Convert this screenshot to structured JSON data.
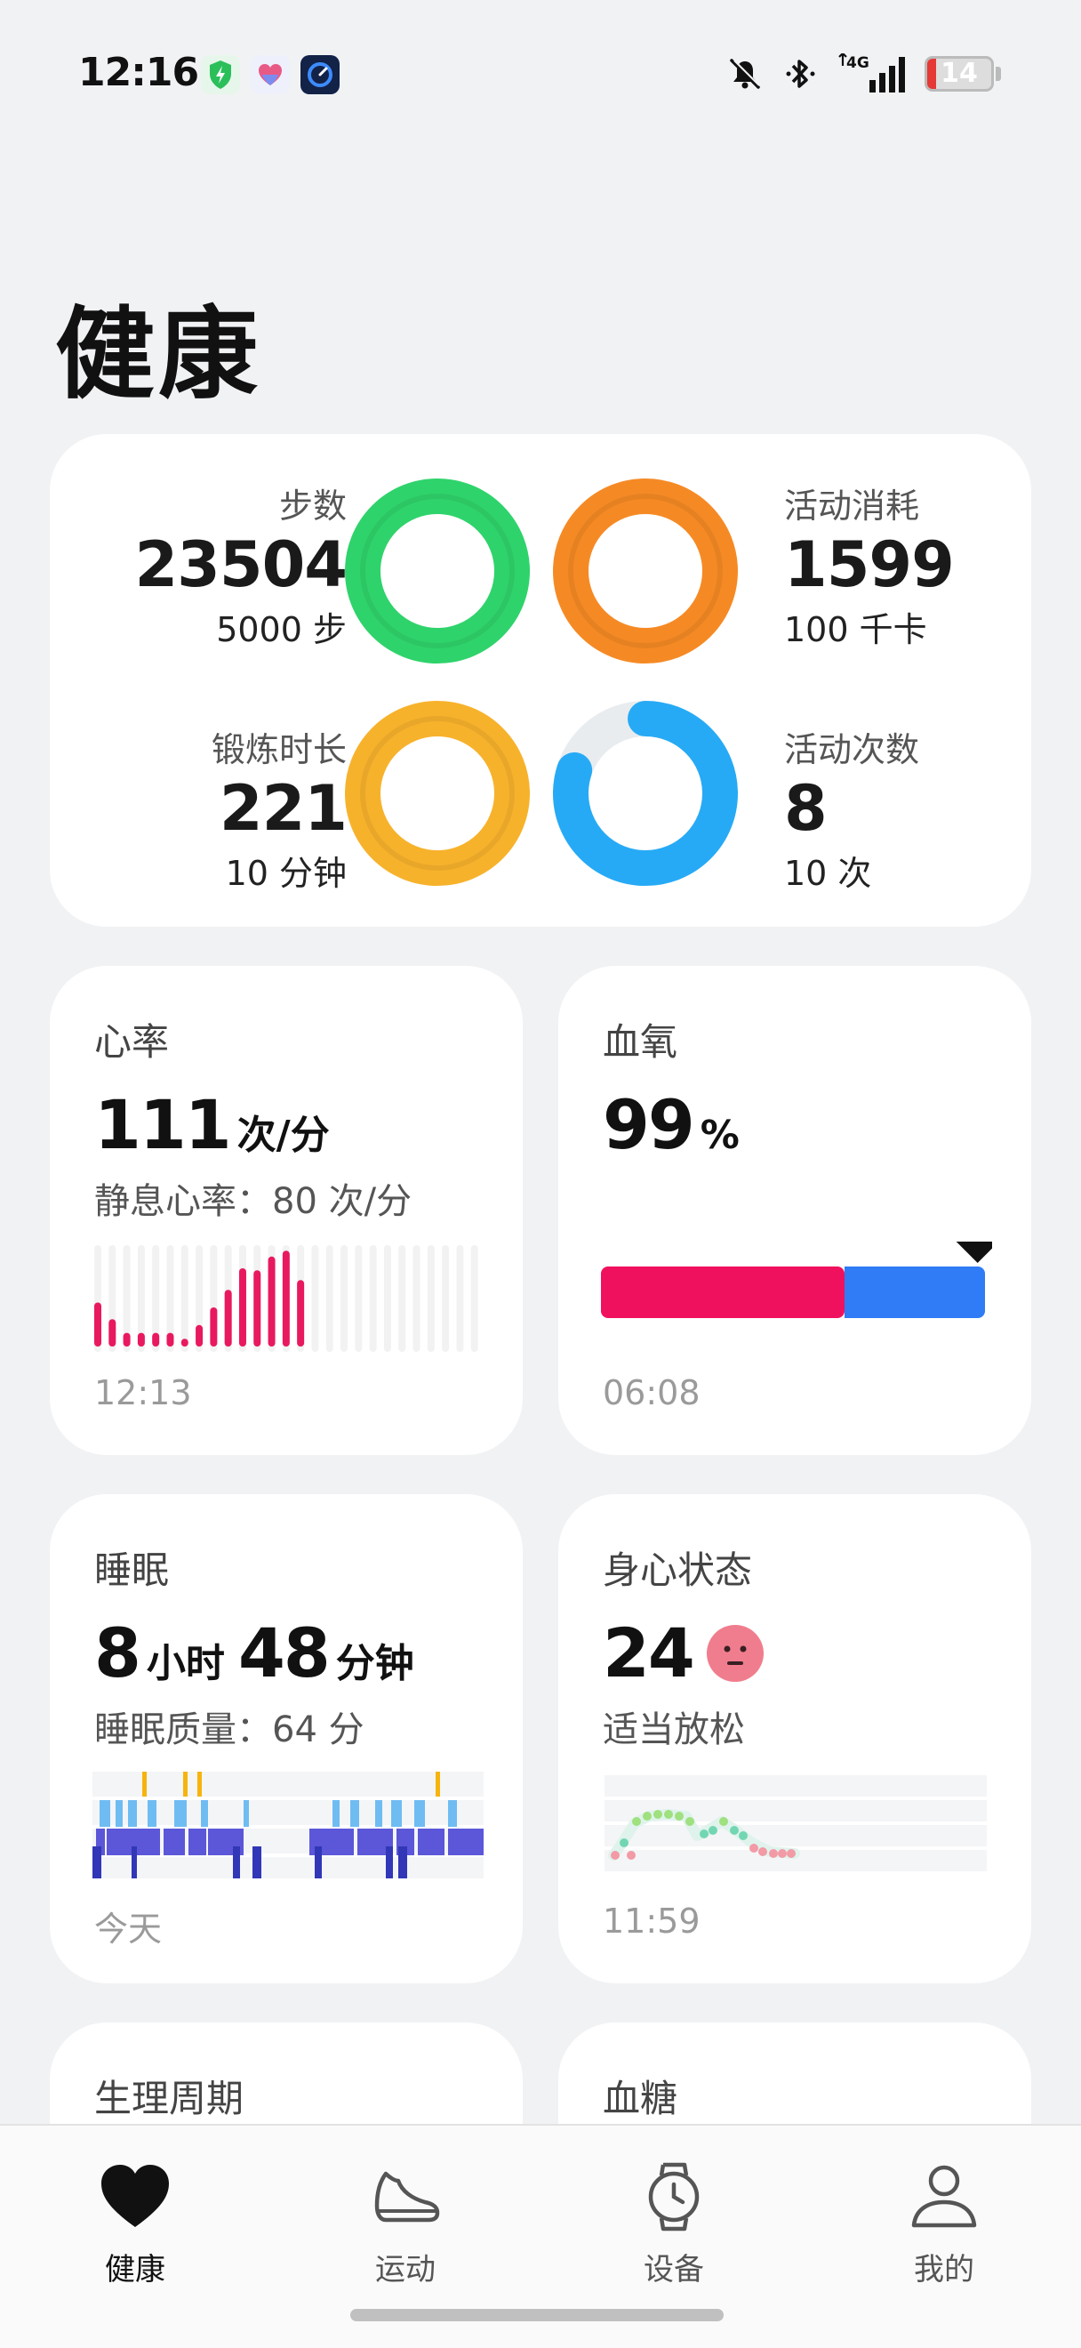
{
  "status_bar": {
    "time": "12:16",
    "apps": [
      "shield-bolt-icon",
      "heart-app-icon",
      "clock-app-icon"
    ],
    "system_icons": [
      "mute-icon",
      "bluetooth-icon",
      "4g-signal-icon"
    ],
    "network": "4G",
    "battery": "14",
    "battery_level": 0.14
  },
  "page_title": "健康",
  "activity": {
    "steps": {
      "label": "步数",
      "value": "23504",
      "goal": "5000 步",
      "color": "#2fd36b"
    },
    "calories": {
      "label": "活动消耗",
      "value": "1599",
      "goal": "100 千卡",
      "color": "#f58a25"
    },
    "exercise": {
      "label": "锻炼时长",
      "value": "221",
      "goal": "10 分钟",
      "color": "#f7b22c"
    },
    "sessions": {
      "label": "活动次数",
      "value": "8",
      "goal": "10 次",
      "color": "#27aaf5",
      "progress": 0.8
    }
  },
  "heart_rate": {
    "title": "心率",
    "value": "111",
    "unit": "次/分",
    "resting": "静息心率：80 次/分",
    "time": "12:13",
    "bars": [
      0.45,
      0.28,
      0.14,
      0.14,
      0.14,
      0.14,
      0.08,
      0.22,
      0.4,
      0.58,
      0.8,
      0.78,
      0.92,
      0.98,
      0.68
    ],
    "color": "#e8195f"
  },
  "spo2": {
    "title": "血氧",
    "value": "99",
    "unit": "%",
    "time": "06:08",
    "level": 0.99,
    "colors": {
      "low": "#f0115e",
      "normal": "#2f7cf6"
    }
  },
  "sleep": {
    "title": "睡眠",
    "hours": "8",
    "hours_unit": "小时",
    "minutes": "48",
    "minutes_unit": "分钟",
    "quality": "睡眠质量：64 分",
    "time": "今天"
  },
  "mind": {
    "title": "身心状态",
    "value": "24",
    "status": "适当放松",
    "time": "11:59",
    "mood_color": "#f07d8d"
  },
  "cycle": {
    "title": "生理周期"
  },
  "glucose": {
    "title": "血糖"
  },
  "nav": {
    "health": "健康",
    "sport": "运动",
    "device": "设备",
    "me": "我的"
  }
}
